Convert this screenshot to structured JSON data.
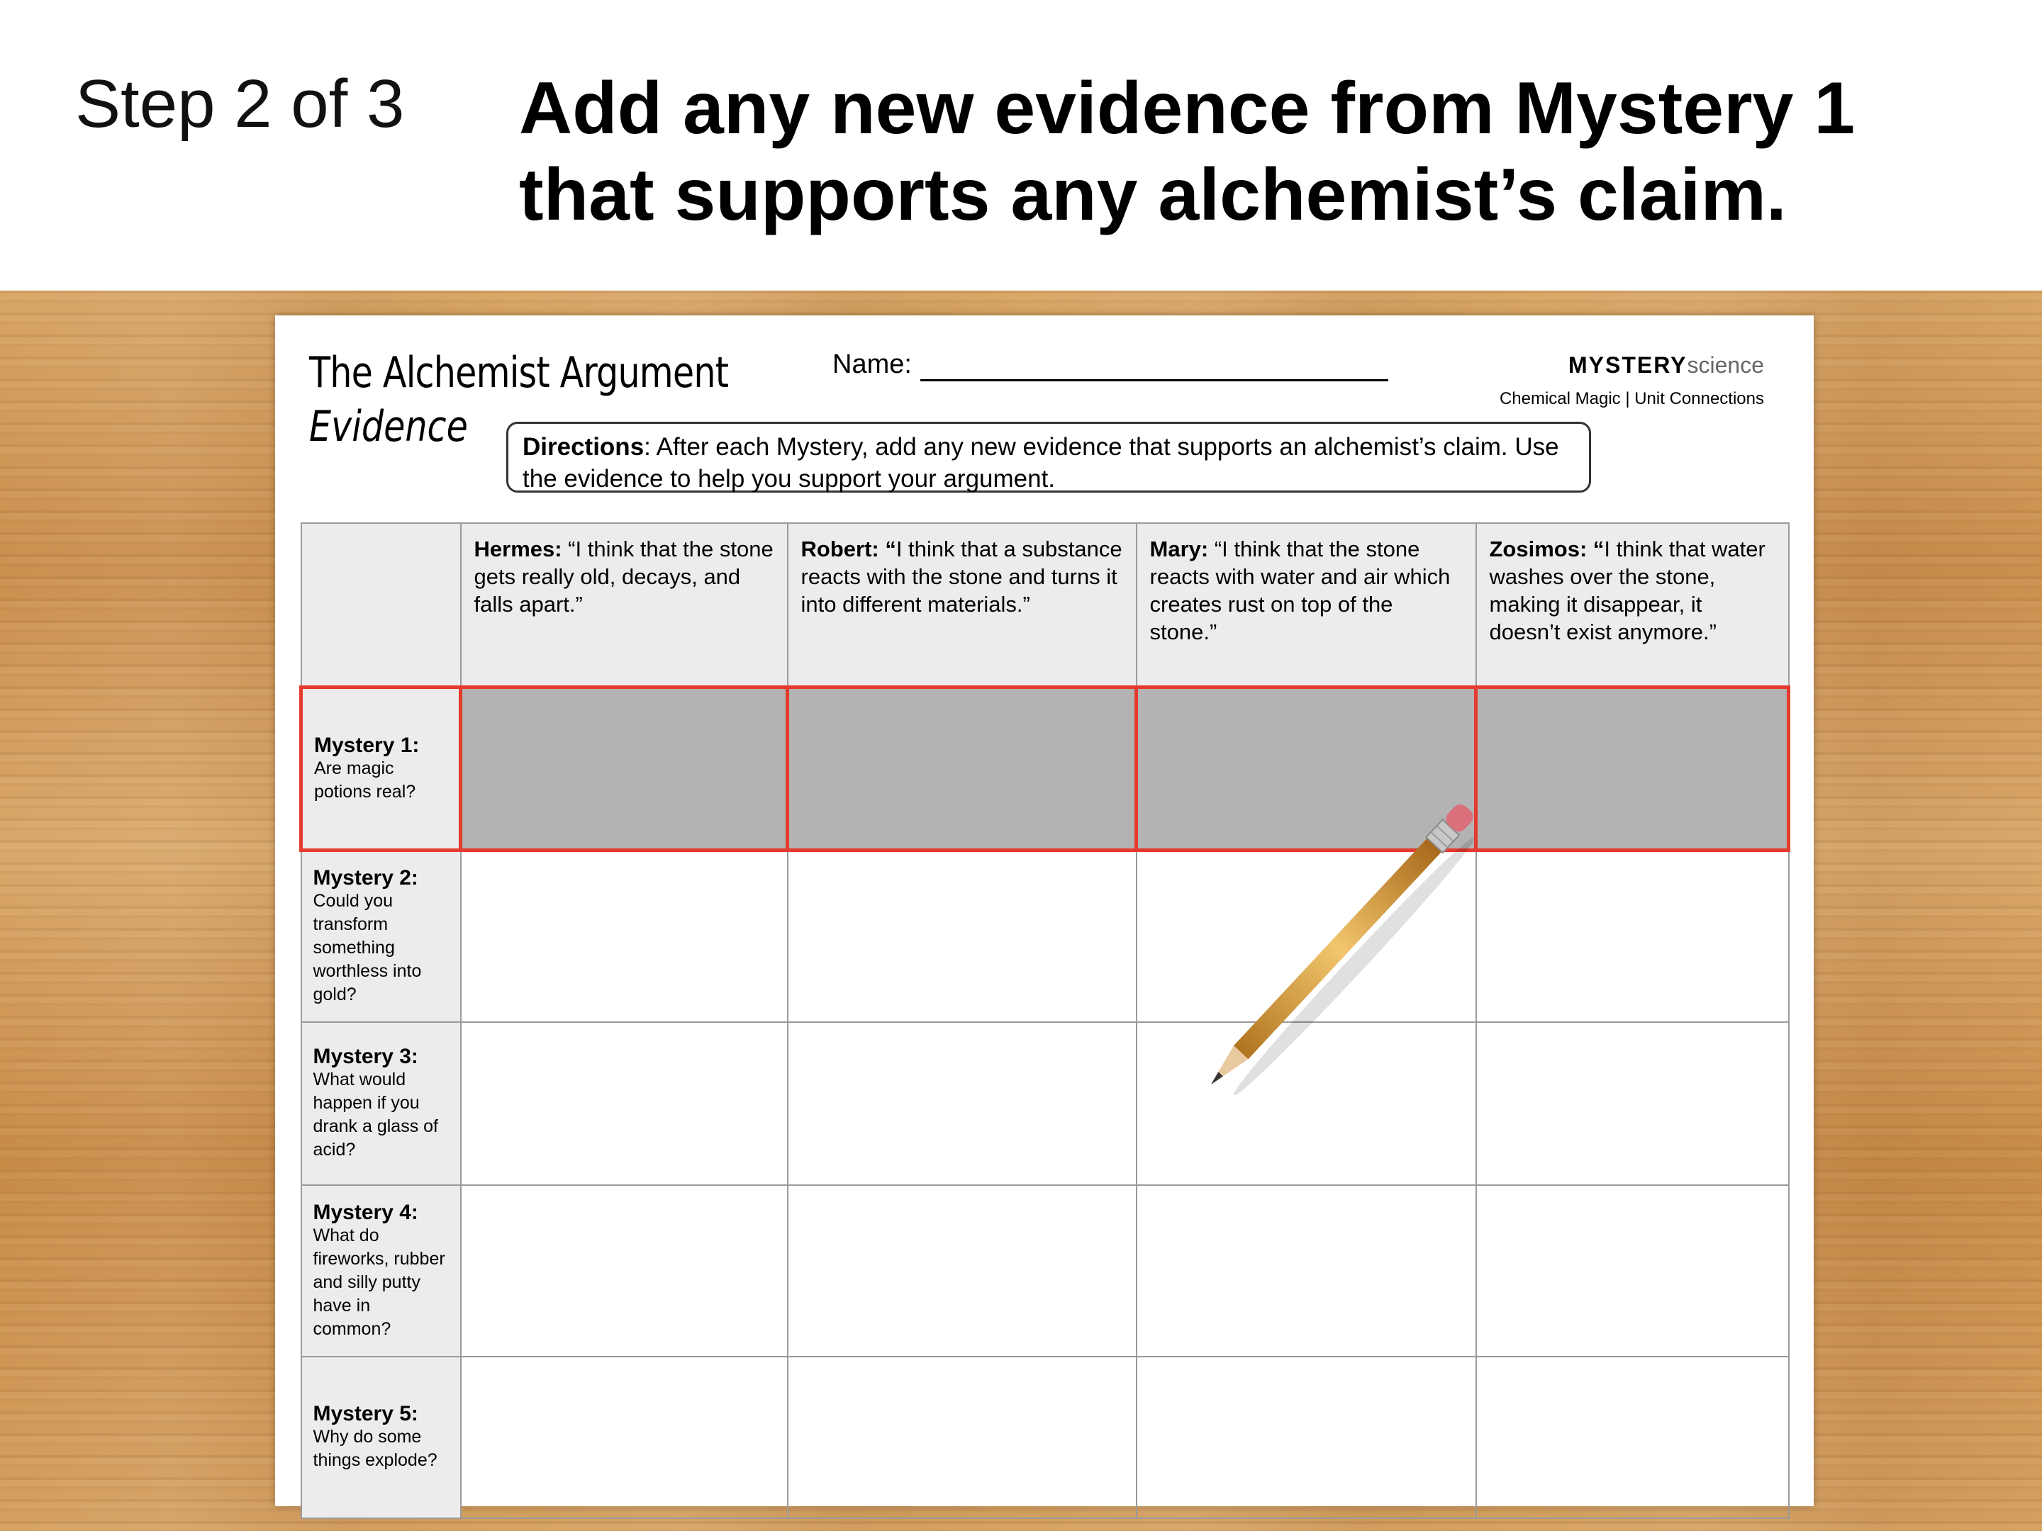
{
  "header": {
    "step": "Step 2 of 3",
    "instruction": "Add any new evidence from Mystery 1 that supports any alchemist’s claim."
  },
  "worksheet": {
    "title": "The Alchemist Argument",
    "subtitle": "Evidence",
    "name_label": "Name:",
    "brand_bold": "MYSTERY",
    "brand_light": "science",
    "unit": "Chemical Magic | Unit Connections",
    "directions_bold": "Directions",
    "directions_text": ": After each Mystery, add any new evidence that supports an alchemist’s claim. Use the evidence to help you support your argument.",
    "claims": [
      {
        "name": "Hermes:",
        "text": " “I think that the stone gets really old, decays, and falls apart.”"
      },
      {
        "name": "Robert: “",
        "text": "I think that a substance reacts with the stone and turns it into different materials.”"
      },
      {
        "name": "Mary:",
        "text": " “I think that the stone reacts with water and air which creates rust on top of the stone.”"
      },
      {
        "name": "Zosimos: “",
        "text": "I think that water washes over the stone, making it disappear, it doesn’t exist anymore.”"
      }
    ],
    "mysteries": [
      {
        "title": "Mystery 1:",
        "question": "Are magic potions real?"
      },
      {
        "title": "Mystery 2:",
        "question": "Could you transform something worthless into gold?"
      },
      {
        "title": "Mystery 3:",
        "question": "What would happen if you drank a glass of acid?"
      },
      {
        "title": "Mystery 4:",
        "question": "What do fireworks, rubber and silly putty have in common?"
      },
      {
        "title": "Mystery 5:",
        "question": "Why do some things explode?"
      }
    ],
    "highlight_color": "#e53a2e"
  }
}
